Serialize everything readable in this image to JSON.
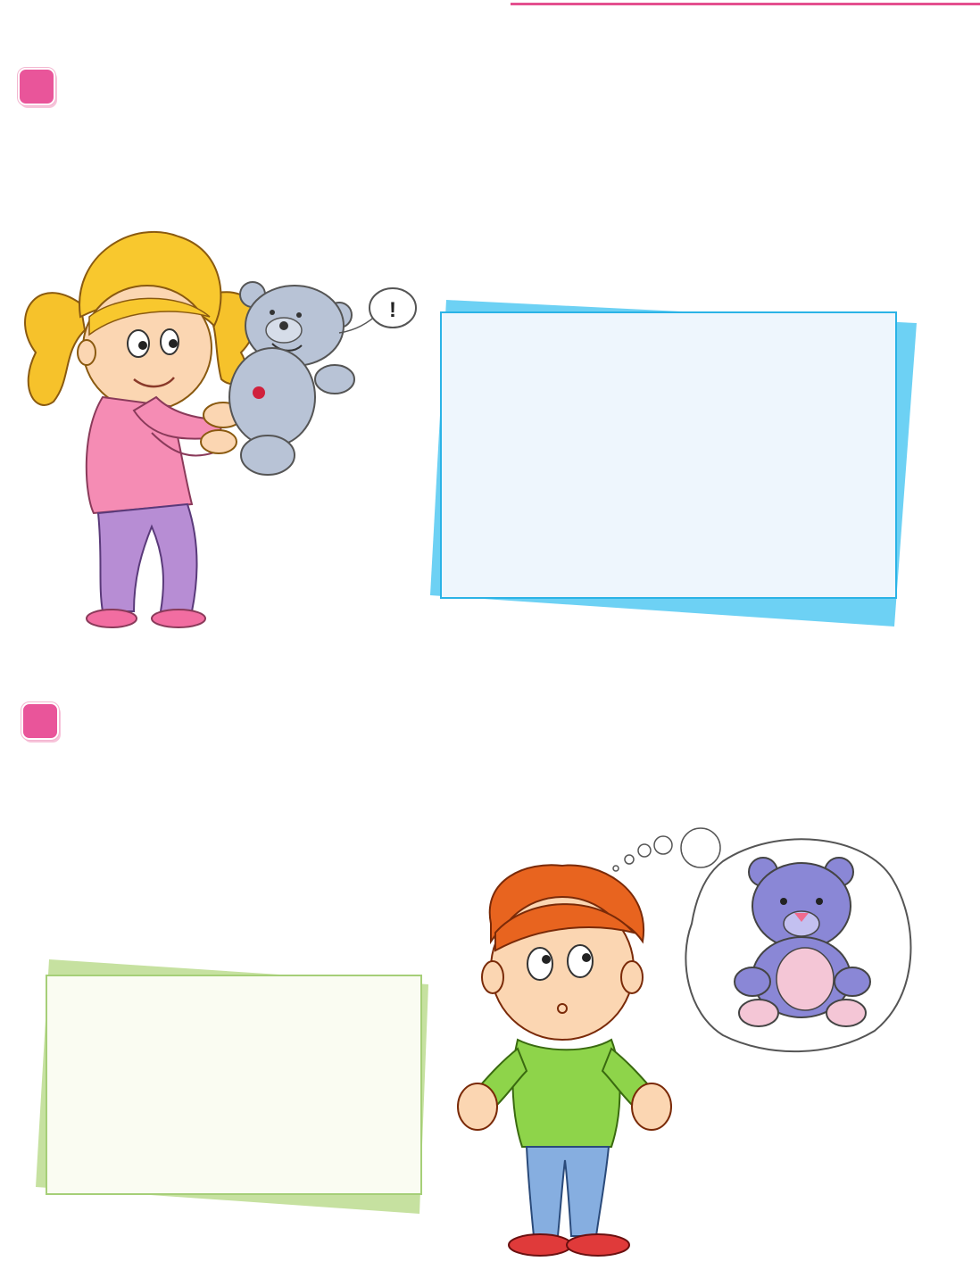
{
  "illustrations": {
    "girl": "girl-holding-teddy-bear",
    "boy": "boy-thinking-of-teddy-bear",
    "exclamation": "!"
  },
  "icons": [
    "bullet-icon",
    "bullet-icon"
  ],
  "colors": {
    "accent_pink": "#e9559a",
    "card_blue_back": "#6dd1f4",
    "card_blue_front": "#eef6fd",
    "card_green_back": "#c6e1a0",
    "card_green_front": "#fafcf2"
  }
}
